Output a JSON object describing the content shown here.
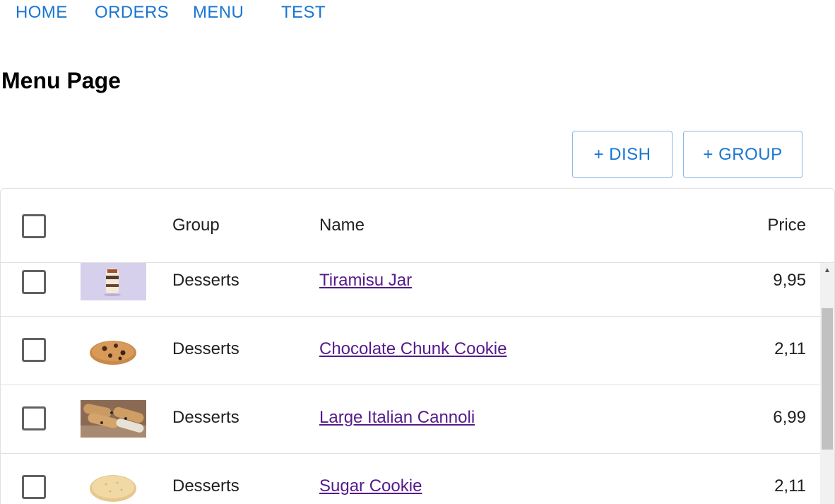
{
  "nav": {
    "home": "HOME",
    "orders": "ORDERS",
    "menu": "MENU",
    "test": "TEST"
  },
  "page": {
    "title": "Menu Page"
  },
  "actions": {
    "add_dish": "+ DISH",
    "add_group": "+ GROUP"
  },
  "table": {
    "headers": {
      "group": "Group",
      "name": "Name",
      "price": "Price"
    },
    "rows": [
      {
        "group": "Desserts",
        "name": "Tiramisu Jar",
        "price": "9,95"
      },
      {
        "group": "Desserts",
        "name": "Chocolate Chunk Cookie",
        "price": "2,11"
      },
      {
        "group": "Desserts",
        "name": "Large Italian Cannoli",
        "price": "6,99"
      },
      {
        "group": "Desserts",
        "name": "Sugar Cookie",
        "price": "2,11"
      }
    ]
  },
  "colors": {
    "accent": "#1976d2",
    "link_visited": "#551a8b",
    "border": "#e0e0e0"
  }
}
